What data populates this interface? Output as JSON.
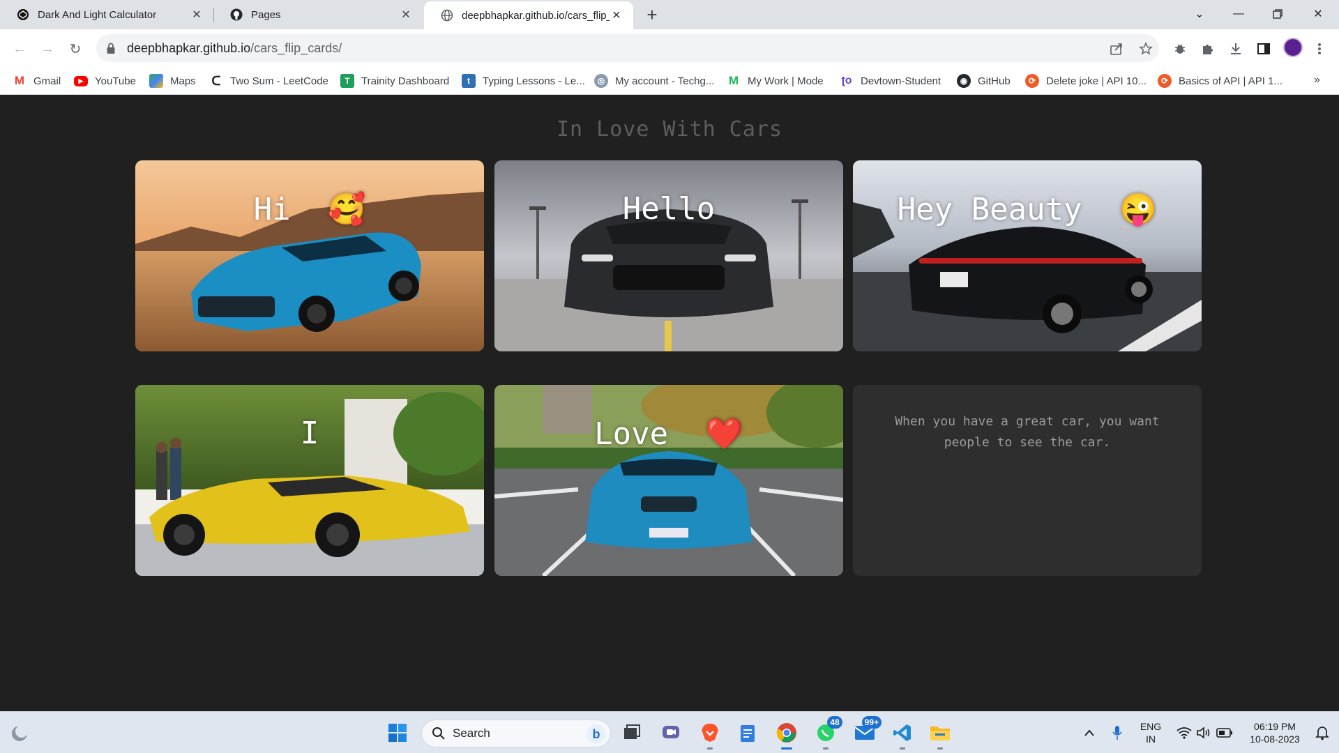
{
  "tabs": [
    {
      "title": "Dark And Light Calculator",
      "icon": "codepen-icon"
    },
    {
      "title": "Pages",
      "icon": "github-icon"
    },
    {
      "title": "deepbhapkar.github.io/cars_flip_c",
      "icon": "globe-icon"
    }
  ],
  "address": {
    "domain": "deepbhapkar.github.io",
    "path": "/cars_flip_cards/"
  },
  "bookmarks": [
    {
      "label": "Gmail",
      "color": "#ea4335"
    },
    {
      "label": "YouTube",
      "color": "#ff0000"
    },
    {
      "label": "Maps",
      "color": "#34a853"
    },
    {
      "label": "Two Sum - LeetCode",
      "color": "#ffa116"
    },
    {
      "label": "Trainity Dashboard",
      "color": "#1e9e5a"
    },
    {
      "label": "Typing Lessons - Le...",
      "color": "#2f6fb5"
    },
    {
      "label": "My account - Techg...",
      "color": "#8a9bb0"
    },
    {
      "label": "My Work | Mode",
      "color": "#1db954"
    },
    {
      "label": "Devtown-Student",
      "color": "#6a3fd8"
    },
    {
      "label": "GitHub",
      "color": "#24292f"
    },
    {
      "label": "Delete joke | API 10...",
      "color": "#ef5b25"
    },
    {
      "label": "Basics of API | API 1...",
      "color": "#ef5b25"
    }
  ],
  "page": {
    "title": "In Love With Cars",
    "cards": [
      {
        "label": "Hi",
        "emoji": "🥰"
      },
      {
        "label": "Hello",
        "emoji": ""
      },
      {
        "label": "Hey Beauty",
        "emoji": "😜"
      },
      {
        "label": "I",
        "emoji": ""
      },
      {
        "label": "Love",
        "emoji": "❤️"
      },
      {
        "quote": "When you have a great car, you want people to see the car."
      }
    ]
  },
  "taskbar": {
    "search_placeholder": "Search",
    "whatsapp_badge": "48",
    "mail_badge": "99+",
    "lang_line1": "ENG",
    "lang_line2": "IN",
    "time": "06:19 PM",
    "date": "10-08-2023"
  },
  "colors": {
    "page_bg": "#202020",
    "title_color": "#5e5e5e",
    "text_card_bg": "#2e2e2e"
  }
}
